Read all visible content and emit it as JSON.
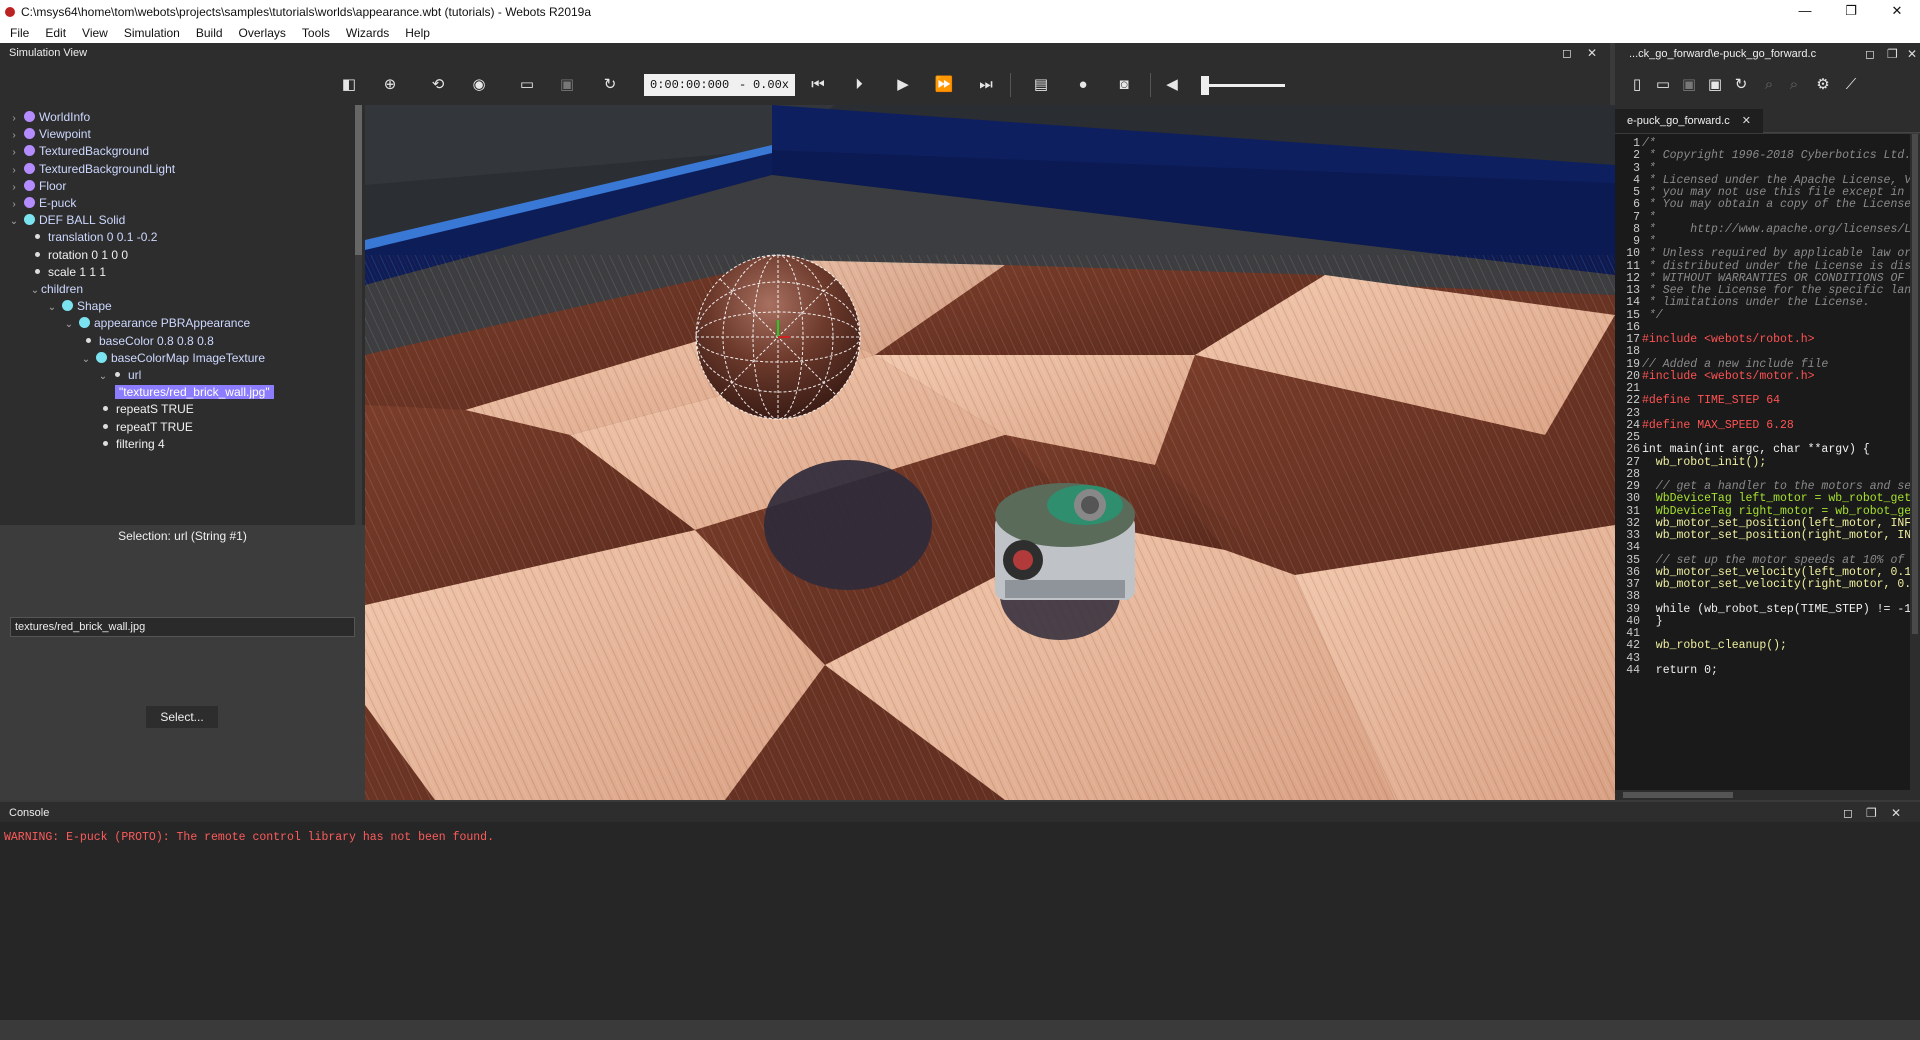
{
  "window": {
    "title": "C:\\msys64\\home\\tom\\webots\\projects\\samples\\tutorials\\worlds\\appearance.wbt (tutorials) - Webots R2019a",
    "minimize": "—",
    "maximize": "❐",
    "close": "✕"
  },
  "menu": [
    "File",
    "Edit",
    "View",
    "Simulation",
    "Build",
    "Overlays",
    "Tools",
    "Wizards",
    "Help"
  ],
  "simulation_view": {
    "title": "Simulation View",
    "time": "0:00:00:000",
    "time_dash": "-",
    "speed": "0.00x"
  },
  "scene_tree": [
    {
      "label": "WorldInfo",
      "level": 0,
      "arrow": "›",
      "kind": "node",
      "color": "purple"
    },
    {
      "label": "Viewpoint",
      "level": 0,
      "arrow": "›",
      "kind": "node",
      "color": "purple"
    },
    {
      "label": "TexturedBackground",
      "level": 0,
      "arrow": "›",
      "kind": "node",
      "color": "purple"
    },
    {
      "label": "TexturedBackgroundLight",
      "level": 0,
      "arrow": "›",
      "kind": "node",
      "color": "purple"
    },
    {
      "label": "Floor",
      "level": 0,
      "arrow": "›",
      "kind": "node",
      "color": "purple"
    },
    {
      "label": "E-puck",
      "level": 0,
      "arrow": "›",
      "kind": "node",
      "color": "purple"
    },
    {
      "label": "DEF BALL Solid",
      "level": 0,
      "arrow": "⌄",
      "kind": "node",
      "color": "cyan"
    },
    {
      "label": "translation 0 0.1 -0.2",
      "level": 1,
      "arrow": "",
      "kind": "field",
      "color": "light"
    },
    {
      "label": "rotation 0 1 0 0",
      "level": 1,
      "arrow": "",
      "kind": "field",
      "color": "white"
    },
    {
      "label": "scale 1 1 1",
      "level": 1,
      "arrow": "",
      "kind": "field",
      "color": "white"
    },
    {
      "label": "children",
      "level": 1,
      "arrow": "⌄",
      "kind": "plain",
      "color": "light"
    },
    {
      "label": "Shape",
      "level": 2,
      "arrow": "⌄",
      "kind": "node",
      "color": "cyan"
    },
    {
      "label": "appearance PBRAppearance",
      "level": 3,
      "arrow": "⌄",
      "kind": "node",
      "color": "cyan"
    },
    {
      "label": "baseColor 0.8 0.8 0.8",
      "level": 4,
      "arrow": "",
      "kind": "field",
      "color": "light"
    },
    {
      "label": "baseColorMap ImageTexture",
      "level": 4,
      "arrow": "⌄",
      "kind": "node",
      "color": "cyan"
    },
    {
      "label": "url",
      "level": 5,
      "arrow": "⌄",
      "kind": "field",
      "color": "light"
    },
    {
      "label": "\"textures/red_brick_wall.jpg\"",
      "level": 6,
      "arrow": "",
      "kind": "selected",
      "color": "white"
    },
    {
      "label": "repeatS TRUE",
      "level": 5,
      "arrow": "",
      "kind": "field",
      "color": "white"
    },
    {
      "label": "repeatT TRUE",
      "level": 5,
      "arrow": "",
      "kind": "field",
      "color": "white"
    },
    {
      "label": "filtering 4",
      "level": 5,
      "arrow": "",
      "kind": "field",
      "color": "white"
    }
  ],
  "field_editor": {
    "selection": "Selection: url (String #1)",
    "value": "textures/red_brick_wall.jpg",
    "select_button": "Select..."
  },
  "editor": {
    "header": "...ck_go_forward\\e-puck_go_forward.c",
    "tab": "e-puck_go_forward.c",
    "tab_close": "✕",
    "lines": [
      {
        "n": "1",
        "t": "/*",
        "c": "com"
      },
      {
        "n": "2",
        "t": " * Copyright 1996-2018 Cyberbotics Ltd.",
        "c": "com"
      },
      {
        "n": "3",
        "t": " *",
        "c": "com"
      },
      {
        "n": "4",
        "t": " * Licensed under the Apache License, V",
        "c": "com"
      },
      {
        "n": "5",
        "t": " * you may not use this file except in",
        "c": "com"
      },
      {
        "n": "6",
        "t": " * You may obtain a copy of the License",
        "c": "com"
      },
      {
        "n": "7",
        "t": " *",
        "c": "com"
      },
      {
        "n": "8",
        "t": " *     http://www.apache.org/licenses/L",
        "c": "com"
      },
      {
        "n": "9",
        "t": " *",
        "c": "com"
      },
      {
        "n": "10",
        "t": " * Unless required by applicable law or",
        "c": "com"
      },
      {
        "n": "11",
        "t": " * distributed under the License is dis",
        "c": "com"
      },
      {
        "n": "12",
        "t": " * WITHOUT WARRANTIES OR CONDITIONS OF A",
        "c": "com"
      },
      {
        "n": "13",
        "t": " * See the License for the specific lan",
        "c": "com"
      },
      {
        "n": "14",
        "t": " * limitations under the License.",
        "c": "com"
      },
      {
        "n": "15",
        "t": " */",
        "c": "com"
      },
      {
        "n": "16",
        "t": "",
        "c": "nm"
      },
      {
        "n": "17",
        "t": "#include <webots/robot.h>",
        "c": "pp"
      },
      {
        "n": "18",
        "t": "",
        "c": "nm"
      },
      {
        "n": "19",
        "t": "// Added a new include file",
        "c": "com"
      },
      {
        "n": "20",
        "t": "#include <webots/motor.h>",
        "c": "pp"
      },
      {
        "n": "21",
        "t": "",
        "c": "nm"
      },
      {
        "n": "22",
        "t": "#define TIME_STEP 64",
        "c": "pp"
      },
      {
        "n": "23",
        "t": "",
        "c": "nm"
      },
      {
        "n": "24",
        "t": "#define MAX_SPEED 6.28",
        "c": "pp"
      },
      {
        "n": "25",
        "t": "",
        "c": "nm"
      },
      {
        "n": "26",
        "t": "int main(int argc, char **argv) {",
        "c": "kw"
      },
      {
        "n": "27",
        "t": "  wb_robot_init();",
        "c": "fn"
      },
      {
        "n": "28",
        "t": "",
        "c": "nm"
      },
      {
        "n": "29",
        "t": "  // get a handler to the motors and se",
        "c": "com"
      },
      {
        "n": "30",
        "t": "  WbDeviceTag left_motor = wb_robot_get",
        "c": "ty"
      },
      {
        "n": "31",
        "t": "  WbDeviceTag right_motor = wb_robot_ge",
        "c": "ty"
      },
      {
        "n": "32",
        "t": "  wb_motor_set_position(left_motor, INF",
        "c": "fn"
      },
      {
        "n": "33",
        "t": "  wb_motor_set_position(right_motor, IN",
        "c": "fn"
      },
      {
        "n": "34",
        "t": "",
        "c": "nm"
      },
      {
        "n": "35",
        "t": "  // set up the motor speeds at 10% of",
        "c": "com"
      },
      {
        "n": "36",
        "t": "  wb_motor_set_velocity(left_motor, 0.1",
        "c": "fn"
      },
      {
        "n": "37",
        "t": "  wb_motor_set_velocity(right_motor, 0.",
        "c": "fn"
      },
      {
        "n": "38",
        "t": "",
        "c": "nm"
      },
      {
        "n": "39",
        "t": "  while (wb_robot_step(TIME_STEP) != -1",
        "c": "kw"
      },
      {
        "n": "40",
        "t": "  }",
        "c": "nm"
      },
      {
        "n": "41",
        "t": "",
        "c": "nm"
      },
      {
        "n": "42",
        "t": "  wb_robot_cleanup();",
        "c": "fn"
      },
      {
        "n": "43",
        "t": "",
        "c": "nm"
      },
      {
        "n": "44",
        "t": "  return 0;",
        "c": "kw"
      }
    ]
  },
  "console": {
    "title": "Console",
    "message": "WARNING: E-puck (PROTO): The remote control library has not been found."
  },
  "colors": {
    "panel": "#2d2d2d",
    "selection": "#8c7cff",
    "warning": "#ff5b5b",
    "wall_blue": "#3a78d6"
  }
}
